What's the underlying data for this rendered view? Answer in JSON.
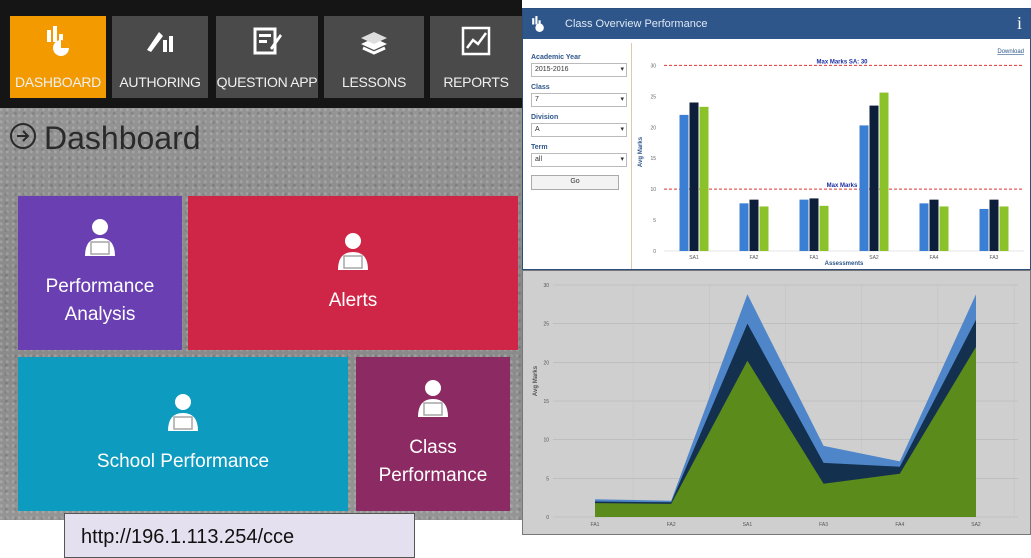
{
  "nav": {
    "items": [
      {
        "label": "DASHBOARD",
        "icon": "dashboard-icon"
      },
      {
        "label": "AUTHORING",
        "icon": "authoring-icon"
      },
      {
        "label": "QUESTION APP",
        "icon": "question-app-icon"
      },
      {
        "label": "LESSONS",
        "icon": "lessons-icon"
      },
      {
        "label": "REPORTS",
        "icon": "reports-icon"
      }
    ],
    "active_color": "#f39a00",
    "tile_color": "#4a4a4a"
  },
  "page": {
    "title": "Dashboard"
  },
  "tiles": [
    {
      "label": "Performance Analysis",
      "color": "#6a3fb1",
      "icon": "user-laptop-icon"
    },
    {
      "label": "Alerts",
      "color": "#cf2647",
      "icon": "user-laptop-icon"
    },
    {
      "label": "School Performance",
      "color": "#0d9bbf",
      "icon": "user-laptop-icon"
    },
    {
      "label": "Class Performance",
      "color": "#8c2a63",
      "icon": "user-laptop-icon"
    }
  ],
  "url": "http://196.1.113.254/cce",
  "class_overview": {
    "title": "Class Overview Performance",
    "info_icon": "i",
    "download_label": "Download",
    "filters": [
      {
        "label": "Academic Year",
        "value": "2015-2016"
      },
      {
        "label": "Class",
        "value": "7"
      },
      {
        "label": "Division",
        "value": "A"
      },
      {
        "label": "Term",
        "value": "all"
      }
    ],
    "go_label": "Go"
  },
  "chart_data": [
    {
      "type": "bar",
      "categories": [
        "SA1",
        "FA2",
        "FA1",
        "SA2",
        "FA4",
        "FA3"
      ],
      "series": [
        {
          "color": "#3b7fd4",
          "values": [
            22,
            7.7,
            8.3,
            20.3,
            7.7,
            6.8
          ]
        },
        {
          "color": "#0c1e3a",
          "values": [
            24,
            8.3,
            8.5,
            23.5,
            8.3,
            8.3
          ]
        },
        {
          "color": "#8cc229",
          "values": [
            23.3,
            7.2,
            7.3,
            25.6,
            7.2,
            7.2
          ]
        }
      ],
      "reference_lines": [
        {
          "label": "Max Marks SA: 30",
          "value": 30
        },
        {
          "label": "Max Marks",
          "value": 10
        }
      ],
      "ylabel": "Avg Marks",
      "xlabel": "Assessments",
      "ylim": [
        0,
        32
      ],
      "yticks": [
        0,
        5,
        10,
        15,
        20,
        25,
        30
      ],
      "grid": false,
      "legend": "none"
    },
    {
      "type": "area",
      "categories": [
        "FA1",
        "FA2",
        "SA1",
        "FA3",
        "FA4",
        "SA2"
      ],
      "series": [
        {
          "color": "#4f86c9",
          "values": [
            2.3,
            2.1,
            28.8,
            9.2,
            7.2,
            28.8
          ]
        },
        {
          "color": "#14304f",
          "values": [
            2.0,
            1.9,
            25.0,
            7.0,
            6.5,
            25.5
          ]
        },
        {
          "color": "#5b8b1a",
          "values": [
            1.8,
            1.7,
            20.2,
            4.3,
            5.6,
            22.0
          ]
        }
      ],
      "ylabel": "Avg Marks",
      "ylim": [
        0,
        30
      ],
      "yticks": [
        0,
        5,
        10,
        15,
        20,
        25,
        30
      ],
      "grid": true,
      "legend": "none"
    }
  ]
}
